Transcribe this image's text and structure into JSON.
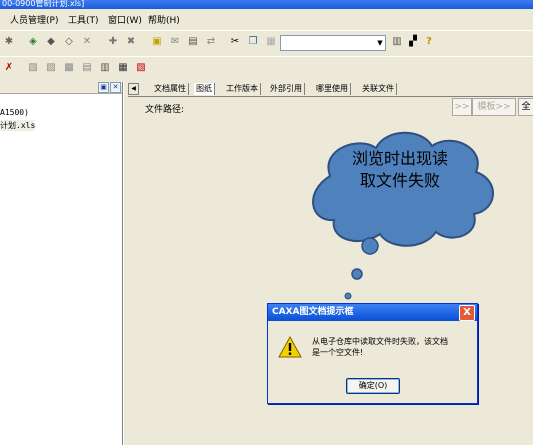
{
  "window": {
    "title": "00-0900管制计划.xls]"
  },
  "menu": [
    {
      "label": "人员管理(P)"
    },
    {
      "label": "工具(T)"
    },
    {
      "label": "窗口(W)"
    },
    {
      "label": "帮助(H)"
    }
  ],
  "left_pane": {
    "tree": [
      "A1500)",
      "计划.xls"
    ]
  },
  "tabs": [
    {
      "label": "文档属性"
    },
    {
      "label": "图纸"
    },
    {
      "label": "工作版本"
    },
    {
      "label": "外部引用"
    },
    {
      "label": "哪里使用"
    },
    {
      "label": "关联文件"
    }
  ],
  "detail": {
    "path_label": "文件路径:",
    "btn_prev": ">>",
    "btn_template": "模板>>",
    "btn_all": "全"
  },
  "annotation": {
    "line1": "浏览时出现读",
    "line2": "取文件失败"
  },
  "dialog": {
    "title": "CAXA图文档提示框",
    "message_line1": "从电子仓库中读取文件时失败，该文档",
    "message_line2": "是一个空文件!",
    "ok_label": "确定(O)",
    "close_label": "X"
  },
  "colors": {
    "cloud_fill": "#4f81bd",
    "cloud_stroke": "#2f4f7f",
    "dialog_title": "#0b4fd6",
    "warning": "#f5d000"
  }
}
